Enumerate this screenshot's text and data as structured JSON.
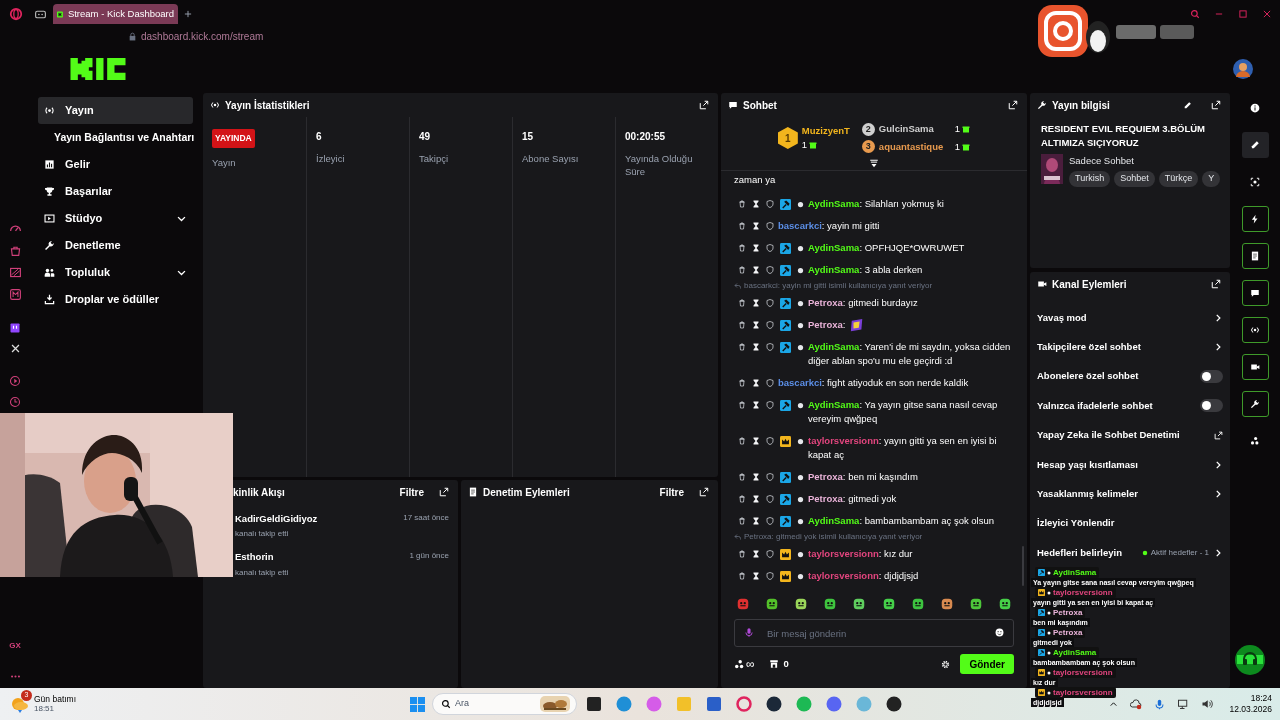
{
  "browser": {
    "tab_title": "Stream - Kick Dashboard",
    "address": "dashboard.kick.com/stream"
  },
  "opera_sidebar": {
    "label": "GX"
  },
  "nav": [
    {
      "label": "Yayın",
      "kind": "item",
      "selected": true,
      "expandable": false
    },
    {
      "label": "Yayın Bağlantısı ve Anahtarı",
      "kind": "subitem",
      "selected": false
    },
    {
      "label": "Gelir",
      "kind": "item",
      "selected": false,
      "expandable": false
    },
    {
      "label": "Başarılar",
      "kind": "item",
      "selected": false,
      "expandable": false
    },
    {
      "label": "Stüdyo",
      "kind": "item",
      "selected": false,
      "expandable": true
    },
    {
      "label": "Denetleme",
      "kind": "item",
      "selected": false,
      "expandable": false
    },
    {
      "label": "Topluluk",
      "kind": "item",
      "selected": false,
      "expandable": true
    },
    {
      "label": "Droplar ve ödüller",
      "kind": "item",
      "selected": false,
      "expandable": false
    }
  ],
  "stats_panel": {
    "title": "Yayın İstatistikleri",
    "columns": [
      {
        "kind": "status",
        "badge": "YAYINDA",
        "label": "Yayın"
      },
      {
        "kind": "number",
        "value": "6",
        "label": "İzleyici"
      },
      {
        "kind": "number",
        "value": "49",
        "label": "Takipçi"
      },
      {
        "kind": "number",
        "value": "15",
        "label": "Abone Sayısı"
      },
      {
        "kind": "number",
        "value": "00:20:55",
        "label": "Yayında Olduğu Süre"
      }
    ]
  },
  "activity_panel": {
    "title": "kinlik Akışı",
    "filter": "Filtre",
    "events": [
      {
        "user": "KadirGeldiGidiyoz",
        "action": "kanalı takip etti",
        "time": "17 saat önce"
      },
      {
        "user": "Esthorin",
        "action": "kanalı takip etti",
        "time": "1 gün önce"
      }
    ]
  },
  "moderation_panel": {
    "title": "Denetim Eylemleri",
    "filter": "Filtre"
  },
  "chat": {
    "title": "Sohbet",
    "leaderboard": [
      {
        "rank": "1",
        "name": "MuzizyenT",
        "count": "1",
        "color": "#f2b51d"
      },
      {
        "rank": "2",
        "name": "GulcinSama",
        "count": "1",
        "color": "#cfcfcf"
      },
      {
        "rank": "3",
        "name": "aquantastique",
        "count": "1",
        "color": "#e89a4e"
      }
    ],
    "messages": [
      {
        "kind": "continuation",
        "text": "zaman ya"
      },
      {
        "kind": "message",
        "mod_badge": true,
        "vip_badge": false,
        "user": "AydinSama",
        "color": "#53fc18",
        "text": ": Silahları yokmuş ki"
      },
      {
        "kind": "message",
        "mod_badge": false,
        "vip_badge": false,
        "user": "bascarkci",
        "color": "#5b8ee6",
        "text": ": yayin mi gitti"
      },
      {
        "kind": "message",
        "mod_badge": true,
        "vip_badge": false,
        "user": "AydinSama",
        "color": "#53fc18",
        "text": ": OPFHJQE*OWRUWET"
      },
      {
        "kind": "message",
        "mod_badge": true,
        "vip_badge": false,
        "user": "AydinSama",
        "color": "#53fc18",
        "text": ": 3 abla derken"
      },
      {
        "kind": "reply_context",
        "text": "bascarkci: yayin mi gitti isimli kullanıcıya yanıt veriyor"
      },
      {
        "kind": "message",
        "mod_badge": true,
        "vip_badge": false,
        "user": "Petroxa",
        "color": "#eab3d9",
        "text": ": gitmedi burdayız"
      },
      {
        "kind": "message",
        "mod_badge": true,
        "vip_badge": false,
        "user": "Petroxa",
        "color": "#eab3d9",
        "text": ":",
        "emote": true
      },
      {
        "kind": "message",
        "mod_badge": true,
        "vip_badge": false,
        "user": "AydinSama",
        "color": "#53fc18",
        "text": ": Yaren'i de mi saydın, yoksa cidden diğer ablan spo'u mu ele geçirdi :d"
      },
      {
        "kind": "message",
        "mod_badge": false,
        "vip_badge": false,
        "user": "bascarkci",
        "color": "#5b8ee6",
        "text": ": fight atiyoduk en son nerde kaldik"
      },
      {
        "kind": "message",
        "mod_badge": true,
        "vip_badge": false,
        "user": "AydinSama",
        "color": "#53fc18",
        "text": ": Ya yayın gitse sana nasıl cevap vereyim qwğpeq"
      },
      {
        "kind": "message",
        "mod_badge": false,
        "vip_badge": true,
        "user": "taylorsversionn",
        "color": "#e2457e",
        "text": ": yayın gitti ya sen en iyisi bi kapat aç"
      },
      {
        "kind": "message",
        "mod_badge": true,
        "vip_badge": false,
        "user": "Petroxa",
        "color": "#eab3d9",
        "text": ": ben mi kaşındım"
      },
      {
        "kind": "message",
        "mod_badge": true,
        "vip_badge": false,
        "user": "Petroxa",
        "color": "#eab3d9",
        "text": ": gitmedi yok"
      },
      {
        "kind": "message",
        "mod_badge": true,
        "vip_badge": false,
        "user": "AydinSama",
        "color": "#53fc18",
        "text": ": bambambambam aç şok olsun"
      },
      {
        "kind": "reply_context",
        "text": "Petroxa: gitmedi yok isimli kullanıcıya yanıt veriyor"
      },
      {
        "kind": "message",
        "mod_badge": false,
        "vip_badge": true,
        "user": "taylorsversionn",
        "color": "#e2457e",
        "text": ": kız dur"
      },
      {
        "kind": "message",
        "mod_badge": false,
        "vip_badge": true,
        "user": "taylorsversionn",
        "color": "#e2457e",
        "text": ": djdjdjsjd"
      }
    ],
    "input": {
      "placeholder": "Bir mesaj gönderin"
    },
    "points": "∞",
    "store_count": "0",
    "send": "Gönder"
  },
  "stream_info": {
    "title": "Yayın bilgisi",
    "stream_title": "RESIDENT EVIL REQUIEM 3.BÖLÜM ALTIMIZA SIÇIYORUZ",
    "category": "Sadece Sohbet",
    "tags": [
      "Turkish",
      "Sohbet",
      "Türkçe",
      "Y"
    ]
  },
  "channel_actions": {
    "title": "Kanal Eylemleri",
    "items": [
      {
        "label": "Yavaş mod",
        "kind": "chevron"
      },
      {
        "label": "Takipçilere özel sohbet",
        "kind": "chevron"
      },
      {
        "label": "Abonelere özel sohbet",
        "kind": "toggle",
        "on": false
      },
      {
        "label": "Yalnızca ifadelerle sohbet",
        "kind": "toggle",
        "on": false
      },
      {
        "label": "Yapay Zeka ile Sohbet Denetimi",
        "kind": "external"
      },
      {
        "label": "Hesap yaşı kısıtlaması",
        "kind": "chevron"
      },
      {
        "label": "Yasaklanmış kelimeler",
        "kind": "chevron"
      },
      {
        "label": "İzleyici Yönlendir",
        "kind": "plain"
      },
      {
        "label": "Hedefleri belirleyin",
        "kind": "goals",
        "status": "Aktif hedefler - 1"
      }
    ]
  },
  "side_tools": [
    {
      "kind": "info",
      "selected": false,
      "highlighted": false
    },
    {
      "kind": "pencil",
      "selected": true,
      "highlighted": false
    },
    {
      "kind": "focus",
      "selected": false,
      "highlighted": false
    },
    {
      "kind": "bolt",
      "selected": false,
      "highlighted": true
    },
    {
      "kind": "note",
      "selected": false,
      "highlighted": true
    },
    {
      "kind": "chat",
      "selected": false,
      "highlighted": true
    },
    {
      "kind": "live",
      "selected": false,
      "highlighted": true
    },
    {
      "kind": "camera",
      "selected": false,
      "highlighted": true
    },
    {
      "kind": "wrench",
      "selected": false,
      "highlighted": true
    },
    {
      "kind": "dots",
      "selected": false,
      "highlighted": false
    }
  ],
  "overlay_chat": [
    {
      "mod_badge": true,
      "vip_badge": false,
      "user": "AydinSama",
      "color": "#53fc18",
      "text": "Ya yayın gitse sana nasıl cevap vereyim qwğpeq"
    },
    {
      "mod_badge": false,
      "vip_badge": true,
      "user": "taylorsversionn",
      "color": "#e2457e",
      "text": "yayın gitti ya sen en iyisi bi kapat aç"
    },
    {
      "mod_badge": true,
      "vip_badge": false,
      "user": "Petroxa",
      "color": "#eab3d9",
      "text": "ben mi kaşındım"
    },
    {
      "mod_badge": true,
      "vip_badge": false,
      "user": "Petroxa",
      "color": "#eab3d9",
      "text": "gitmedi yok"
    },
    {
      "mod_badge": true,
      "vip_badge": false,
      "user": "AydinSama",
      "color": "#53fc18",
      "text": "bambambambam aç şok olsun"
    },
    {
      "mod_badge": false,
      "vip_badge": true,
      "user": "taylorsversionn",
      "color": "#e2457e",
      "text": "kız dur"
    },
    {
      "mod_badge": false,
      "vip_badge": true,
      "user": "taylorsversionn",
      "color": "#e2457e",
      "text": "djdjdjsjd"
    }
  ],
  "taskbar": {
    "weather_badge": "3",
    "weather_label": "Gün batımı",
    "weather_time": "18:51",
    "search_placeholder": "Ara",
    "time": "18:24",
    "date": "12.03.2026"
  }
}
